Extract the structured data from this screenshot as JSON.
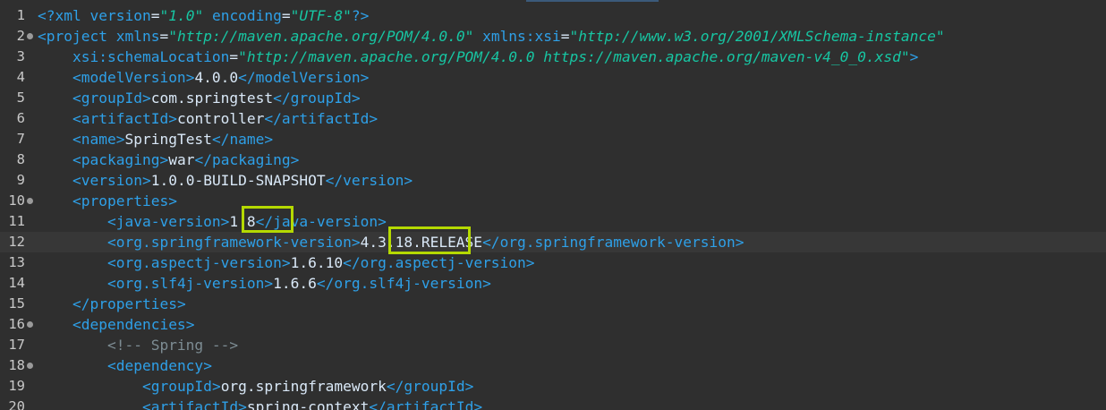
{
  "lines": [
    {
      "n": "1",
      "fold": false,
      "code": "<?xml version=\"1.0\" encoding=\"UTF-8\"?>"
    },
    {
      "n": "2",
      "fold": true,
      "code": "<project xmlns=\"http://maven.apache.org/POM/4.0.0\" xmlns:xsi=\"http://www.w3.org/2001/XMLSchema-instance\""
    },
    {
      "n": "3",
      "fold": false,
      "code": "    xsi:schemaLocation=\"http://maven.apache.org/POM/4.0.0 https://maven.apache.org/maven-v4_0_0.xsd\">"
    },
    {
      "n": "4",
      "fold": false,
      "code": "    <modelVersion>4.0.0</modelVersion>"
    },
    {
      "n": "5",
      "fold": false,
      "code": "    <groupId>com.springtest</groupId>"
    },
    {
      "n": "6",
      "fold": false,
      "code": "    <artifactId>controller</artifactId>"
    },
    {
      "n": "7",
      "fold": false,
      "code": "    <name>SpringTest</name>"
    },
    {
      "n": "8",
      "fold": false,
      "code": "    <packaging>war</packaging>"
    },
    {
      "n": "9",
      "fold": false,
      "code": "    <version>1.0.0-BUILD-SNAPSHOT</version>"
    },
    {
      "n": "10",
      "fold": true,
      "code": "    <properties>"
    },
    {
      "n": "11",
      "fold": false,
      "code": "        <java-version>1.8</java-version>"
    },
    {
      "n": "12",
      "fold": false,
      "code": "        <org.springframework-version>4.3.18.RELEASE</org.springframework-version>",
      "current": true
    },
    {
      "n": "13",
      "fold": false,
      "code": "        <org.aspectj-version>1.6.10</org.aspectj-version>"
    },
    {
      "n": "14",
      "fold": false,
      "code": "        <org.slf4j-version>1.6.6</org.slf4j-version>"
    },
    {
      "n": "15",
      "fold": false,
      "code": "    </properties>"
    },
    {
      "n": "16",
      "fold": true,
      "code": "    <dependencies>"
    },
    {
      "n": "17",
      "fold": false,
      "code": "        <!-- Spring -->"
    },
    {
      "n": "18",
      "fold": true,
      "code": "        <dependency>"
    },
    {
      "n": "19",
      "fold": false,
      "code": "            <groupId>org.springframework</groupId>"
    },
    {
      "n": "20",
      "fold": false,
      "code": "            <artifactId>spring-context</artifactId>"
    }
  ],
  "colors": {
    "background": "#2f2f2f",
    "tag": "#2ea0e8",
    "string": "#17c6a3",
    "text": "#d9e8f7",
    "highlight": "#b5d900"
  }
}
